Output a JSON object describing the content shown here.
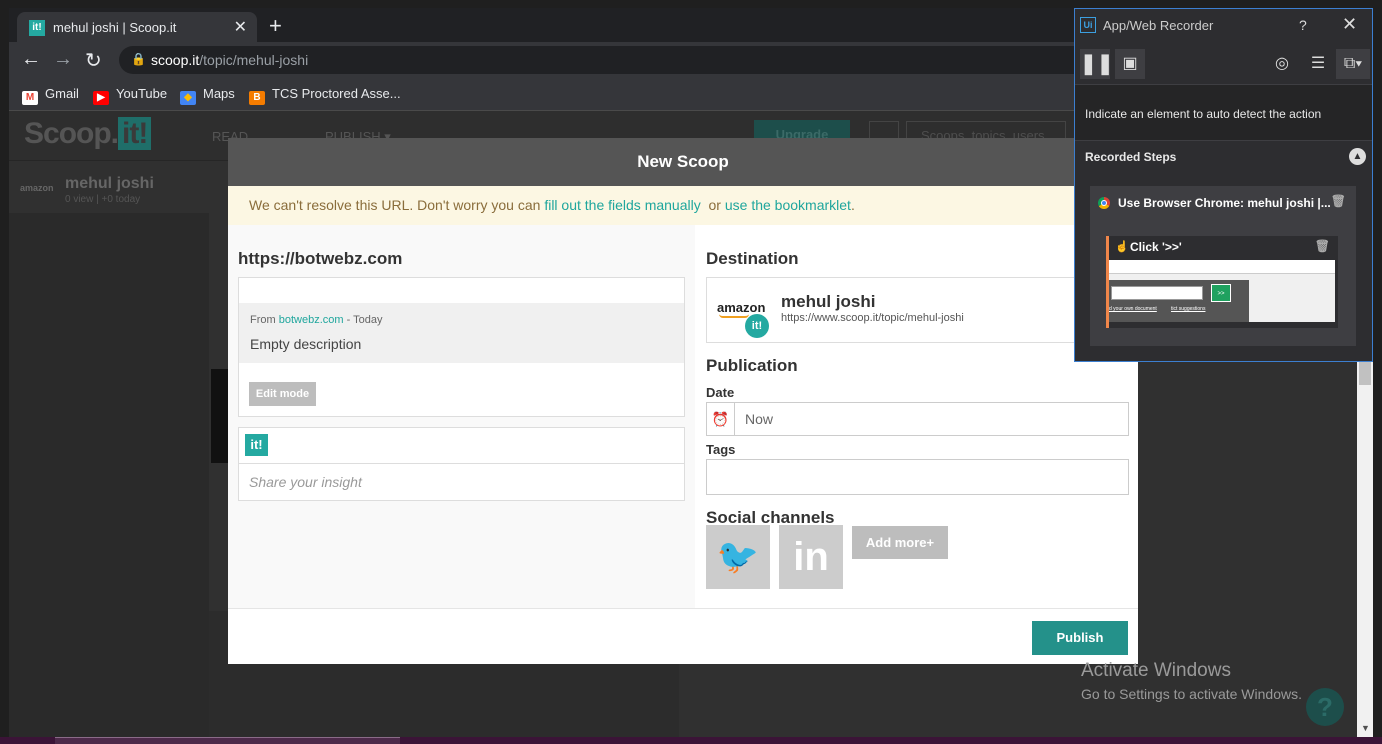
{
  "browser": {
    "tab_title": "mehul joshi | Scoop.it",
    "tab_favicon": "it!",
    "tab_close": "✕",
    "new_tab": "+",
    "url_host": "scoop.it",
    "url_path": "/topic/mehul-joshi",
    "bookmarks": [
      {
        "label": "Gmail",
        "icon": "M",
        "color": "#ea4335"
      },
      {
        "label": "YouTube",
        "icon": "▶",
        "color": "#ff0000"
      },
      {
        "label": "Maps",
        "icon": "◆",
        "color": "#34a853"
      },
      {
        "label": "TCS Proctored Asse...",
        "icon": "B",
        "color": "#f57c00"
      }
    ]
  },
  "background_page": {
    "logo_text": "Scoop.",
    "logo_it": "it!",
    "nav_read": "READ",
    "nav_publish": "PUBLISH ▾",
    "upgrade": "Upgrade",
    "search_placeholder": "Scoops, topics, users",
    "user_logo": "amazon",
    "user_name": "mehul joshi",
    "user_stats": "0 view | +0 today"
  },
  "modal": {
    "title": "New Scoop",
    "warning_prefix": "We can't resolve this URL. Don't worry you can ",
    "warning_link1": "fill out the fields manually",
    "warning_mid": "  or ",
    "warning_link2": "use the bookmarklet",
    "warning_suffix": ".",
    "source_url": "https://botwebz.com",
    "from_prefix": "From ",
    "from_domain": "botwebz.com",
    "from_suffix": " - Today",
    "description": "Empty description",
    "edit_mode": "Edit mode",
    "insight_logo": "it!",
    "insight_placeholder": "Share your insight",
    "destination_heading": "Destination",
    "destination_logo": "amazon",
    "destination_badge": "it!",
    "destination_name": "mehul joshi",
    "destination_url": "https://www.scoop.it/topic/mehul-joshi",
    "publication_heading": "Publication",
    "date_label": "Date",
    "date_value": "Now",
    "tags_label": "Tags",
    "social_heading": "Social channels",
    "social_twitter": "🐦",
    "social_linkedin": "in",
    "add_more": "Add more+",
    "publish": "Publish"
  },
  "recorder": {
    "logo": "Ui",
    "title": "App/Web Recorder",
    "help": "?",
    "close": "✕",
    "hint": "Indicate an element to auto detect the action",
    "steps_heading": "Recorded Steps",
    "step_label": "Use Browser Chrome: mehul joshi |...",
    "substep_label": "Click '>>'",
    "thumb_link1": "d your own document",
    "thumb_link2": "tict suggestions",
    "thumb_go": ">>"
  },
  "watermark": {
    "line1": "Activate Windows",
    "line2": "Go to Settings to activate Windows."
  }
}
